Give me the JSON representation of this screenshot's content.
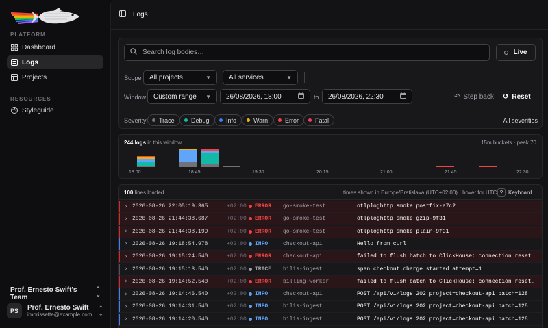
{
  "sidebar": {
    "platform_label": "PLATFORM",
    "resources_label": "RESOURCES",
    "items": [
      {
        "label": "Dashboard",
        "icon": "grid-icon"
      },
      {
        "label": "Logs",
        "icon": "logs-icon"
      },
      {
        "label": "Projects",
        "icon": "projects-icon"
      },
      {
        "label": "Styleguide",
        "icon": "palette-icon"
      }
    ],
    "team": "Prof. Ernesto Swift's Team",
    "user": {
      "initials": "PS",
      "name": "Prof. Ernesto Swift",
      "email": "imorissette@example.com"
    }
  },
  "header": {
    "title": "Logs"
  },
  "search": {
    "placeholder": "Search log bodies…",
    "live_label": "Live"
  },
  "filters": {
    "scope_label": "Scope",
    "project": "All projects",
    "service": "All services",
    "window_label": "Window",
    "range": "Custom range",
    "from": "26/08/2026, 18:00",
    "to_label": "to",
    "to": "26/08/2026, 22:30",
    "step_back": "Step back",
    "reset": "Reset",
    "severity_label": "Severity",
    "severities": [
      {
        "label": "Trace",
        "color": "#71717a"
      },
      {
        "label": "Debug",
        "color": "#14b8a6"
      },
      {
        "label": "Info",
        "color": "#3b82f6"
      },
      {
        "label": "Warn",
        "color": "#eab308"
      },
      {
        "label": "Error",
        "color": "#ef4444"
      },
      {
        "label": "Fatal",
        "color": "#f43f5e"
      }
    ],
    "all_severities": "All severities"
  },
  "histogram": {
    "count": "244 logs",
    "count_suffix": "in this window",
    "meta": "15m buckets · peak 70",
    "ticks": [
      "18:00",
      "18:45",
      "19:30",
      "20:15",
      "21:00",
      "21:45",
      "22:30"
    ]
  },
  "chart_data": {
    "type": "bar",
    "categories": [
      "18:00",
      "18:15",
      "18:30",
      "18:45",
      "19:00",
      "19:15",
      "19:30",
      "19:45",
      "20:00",
      "20:15",
      "20:30",
      "20:45",
      "21:00",
      "21:15",
      "21:30",
      "21:45",
      "22:00",
      "22:15"
    ],
    "series": [
      {
        "name": "Trace",
        "values": [
          6,
          0,
          18,
          14,
          2,
          0,
          0,
          0,
          0,
          0,
          0,
          0,
          0,
          0,
          0,
          0,
          0,
          0
        ],
        "color": "#71717a"
      },
      {
        "name": "Debug",
        "values": [
          12,
          0,
          0,
          40,
          0,
          0,
          0,
          0,
          0,
          0,
          0,
          0,
          0,
          0,
          0,
          0,
          0,
          0
        ],
        "color": "#14b8a6"
      },
      {
        "name": "Info",
        "values": [
          14,
          0,
          50,
          8,
          0,
          0,
          0,
          0,
          0,
          0,
          0,
          0,
          0,
          0,
          0,
          0,
          0,
          0
        ],
        "color": "#60a5fa"
      },
      {
        "name": "Warn",
        "values": [
          6,
          0,
          2,
          4,
          0,
          0,
          0,
          0,
          0,
          0,
          0,
          0,
          0,
          0,
          0,
          0,
          0,
          0
        ],
        "color": "#eab308"
      },
      {
        "name": "Error",
        "values": [
          4,
          0,
          0,
          4,
          0,
          0,
          0,
          0,
          0,
          0,
          0,
          0,
          0,
          0,
          2,
          0,
          2,
          0
        ],
        "color": "#ef4444"
      }
    ],
    "ylim": [
      0,
      70
    ]
  },
  "logs": {
    "loaded": "100",
    "loaded_suffix": "lines loaded",
    "tz_note": "times shown in Europe/Bratislava (UTC+02:00) · hover for UTC",
    "keyboard_key": "?",
    "keyboard_label": "Keyboard",
    "rows": [
      {
        "ts": "2026-08-26 22:05:19.365",
        "tz": "+02:00",
        "level": "ERROR",
        "service": "go-smoke-test",
        "msg": "otlploghttp smoke postfix-a7c2",
        "kind": "err"
      },
      {
        "ts": "2026-08-26 21:44:38.687",
        "tz": "+02:00",
        "level": "ERROR",
        "service": "go-smoke-test",
        "msg": "otlploghttp smoke gzip-9f31",
        "kind": "err"
      },
      {
        "ts": "2026-08-26 21:44:38.199",
        "tz": "+02:00",
        "level": "ERROR",
        "service": "go-smoke-test",
        "msg": "otlploghttp smoke plain-9f31",
        "kind": "err"
      },
      {
        "ts": "2026-08-26 19:18:54.978",
        "tz": "+02:00",
        "level": "INFO",
        "service": "checkout-api",
        "msg": "Hello from curl",
        "kind": "inf"
      },
      {
        "ts": "2026-08-26 19:15:24.540",
        "tz": "+02:00",
        "level": "ERROR",
        "service": "checkout-api",
        "msg": "failed to flush batch to ClickHouse: connection reset by pe…",
        "kind": "err"
      },
      {
        "ts": "2026-08-26 19:15:13.540",
        "tz": "+02:00",
        "level": "TRACE",
        "service": "bilis-ingest",
        "msg": "span checkout.charge started attempt=1",
        "kind": "trc"
      },
      {
        "ts": "2026-08-26 19:14:52.540",
        "tz": "+02:00",
        "level": "ERROR",
        "service": "billing-worker",
        "msg": "failed to flush batch to ClickHouse: connection reset by pe…",
        "kind": "err"
      },
      {
        "ts": "2026-08-26 19:14:46.540",
        "tz": "+02:00",
        "level": "INFO",
        "service": "checkout-api",
        "msg": "POST /api/v1/logs 202 project=checkout-api batch=128",
        "kind": "inf"
      },
      {
        "ts": "2026-08-26 19:14:31.540",
        "tz": "+02:00",
        "level": "INFO",
        "service": "bilis-ingest",
        "msg": "POST /api/v1/logs 202 project=checkout-api batch=128",
        "kind": "inf"
      },
      {
        "ts": "2026-08-26 19:14:20.540",
        "tz": "+02:00",
        "level": "INFO",
        "service": "bilis-ingest",
        "msg": "POST /api/v1/logs 202 project=checkout-api batch=128",
        "kind": "inf"
      }
    ]
  }
}
